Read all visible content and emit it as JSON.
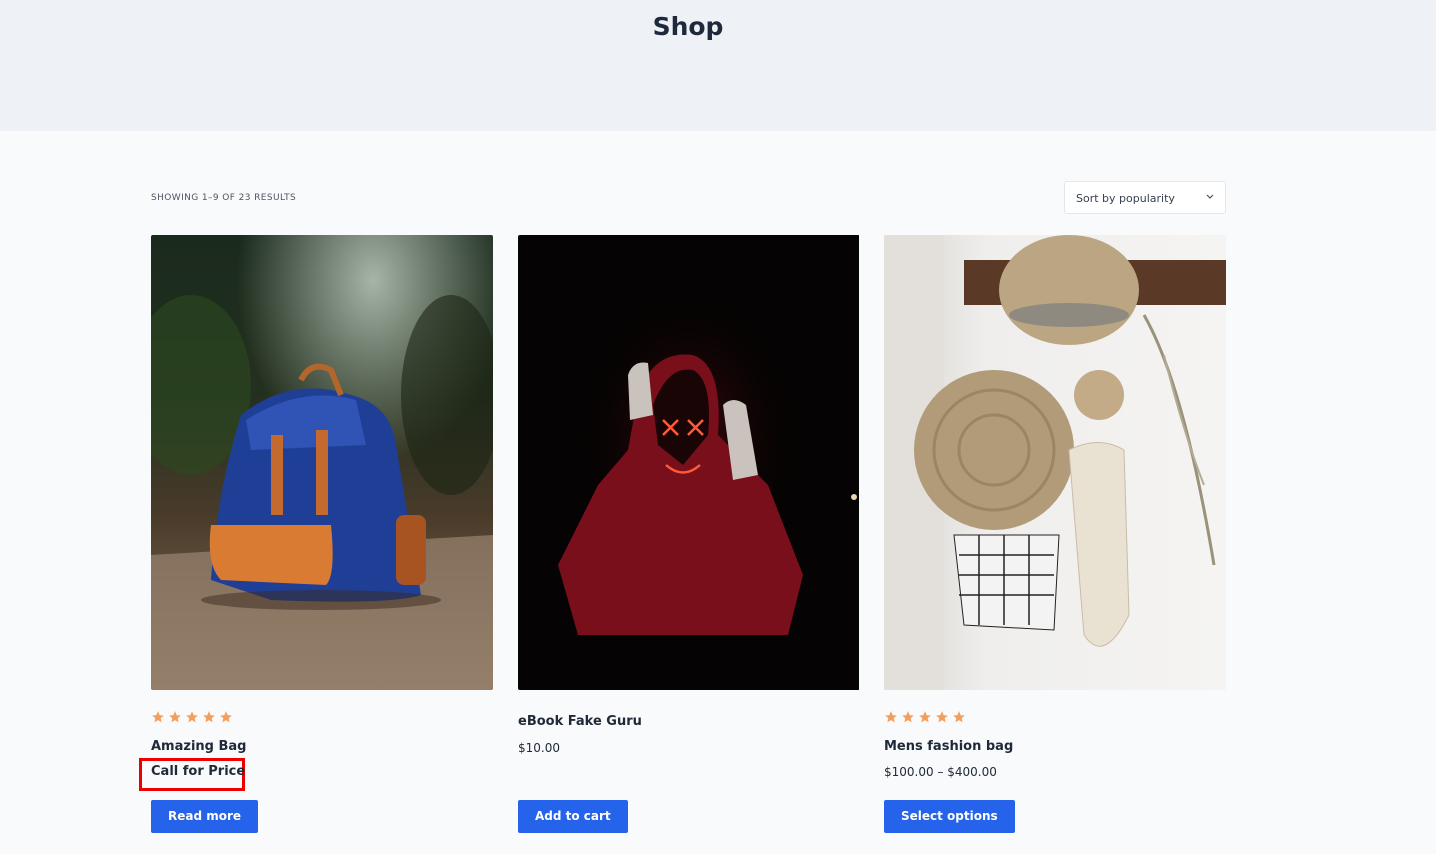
{
  "header": {
    "title": "Shop"
  },
  "toolbar": {
    "result_count": "SHOWING 1–9 OF 23 RESULTS",
    "sort_label": "Sort by popularity"
  },
  "colors": {
    "accent": "#2563eb",
    "star": "#f59e5c",
    "highlight": "#ef0000"
  },
  "products": [
    {
      "title": "Amazing Bag",
      "price": "Call for Price",
      "rating": 5,
      "button": "Read more",
      "image": "blue-backpack-photo"
    },
    {
      "title": "eBook Fake Guru",
      "price": "$10.00",
      "rating": 0,
      "button": "Add to cart",
      "image": "neon-mask-hoodie-photo"
    },
    {
      "title": "Mens fashion bag",
      "price": "$100.00 – $400.00",
      "rating": 5,
      "button": "Select options",
      "image": "straw-bag-hat-photo"
    }
  ]
}
